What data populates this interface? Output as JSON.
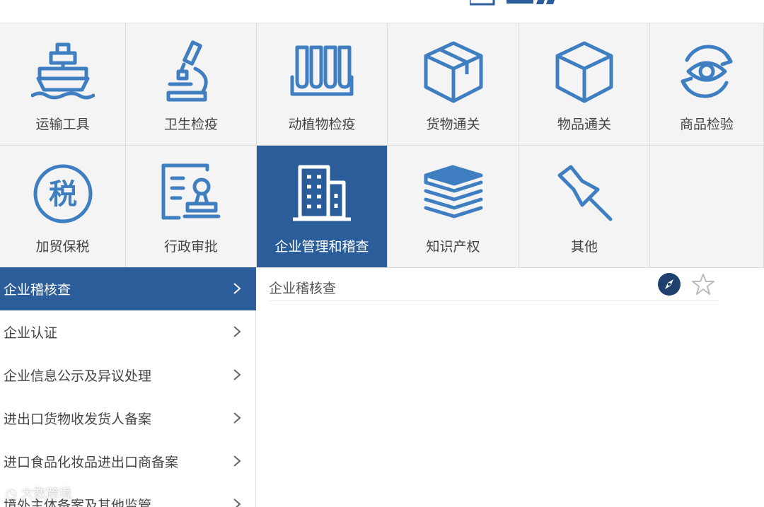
{
  "accent_color": "#2c5d9b",
  "icon_color": "#3f7fc1",
  "tiles": [
    {
      "label": "运输工具",
      "icon": "ship-icon"
    },
    {
      "label": "卫生检疫",
      "icon": "microscope-icon"
    },
    {
      "label": "动植物检疫",
      "icon": "test-tubes-icon"
    },
    {
      "label": "货物通关",
      "icon": "package-icon"
    },
    {
      "label": "物品通关",
      "icon": "box-icon"
    },
    {
      "label": "商品检验",
      "icon": "eye-refresh-icon"
    },
    {
      "label": "加贸保税",
      "icon": "tax-icon"
    },
    {
      "label": "行政审批",
      "icon": "approval-stamp-icon"
    },
    {
      "label": "企业管理和稽查",
      "icon": "building-icon"
    },
    {
      "label": "知识产权",
      "icon": "books-icon"
    },
    {
      "label": "其他",
      "icon": "pushpin-icon"
    }
  ],
  "tax_glyph": "税",
  "sidebar": [
    {
      "label": "企业稽核查"
    },
    {
      "label": "企业认证"
    },
    {
      "label": "企业信息公示及异议处理"
    },
    {
      "label": "进出口货物收发货人备案"
    },
    {
      "label": "进口食品化妆品进出口商备案"
    },
    {
      "label": "境外主体备案及其他监管"
    }
  ],
  "content": {
    "title": "企业稽核查"
  },
  "watermark": "大数跨境"
}
